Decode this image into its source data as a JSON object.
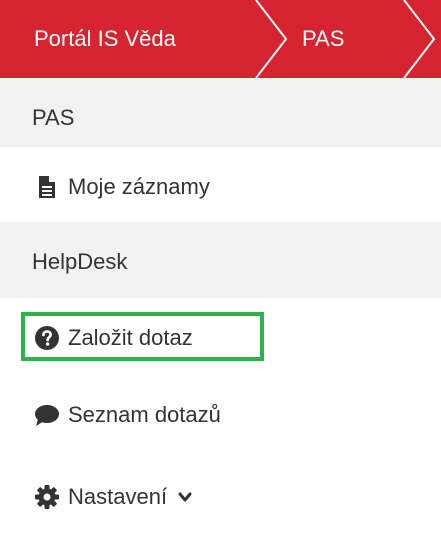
{
  "breadcrumb": {
    "items": [
      {
        "label": "Portál IS Věda"
      },
      {
        "label": "PAS"
      }
    ],
    "bar_color": "#d5242f"
  },
  "menu": {
    "section_pas": {
      "label": "PAS"
    },
    "moje_zaznamy": {
      "label": "Moje záznamy",
      "icon": "file-icon"
    },
    "section_helpdesk": {
      "label": "HelpDesk"
    },
    "zalozit_dotaz": {
      "label": "Založit dotaz",
      "icon": "question-circle-icon",
      "highlighted": true,
      "highlight_color": "#2db34a"
    },
    "seznam_dotazu": {
      "label": "Seznam dotazů",
      "icon": "comment-icon"
    },
    "nastaveni": {
      "label": "Nastavení",
      "icon": "gear-icon",
      "dropdown": "chevron-down-icon"
    }
  }
}
